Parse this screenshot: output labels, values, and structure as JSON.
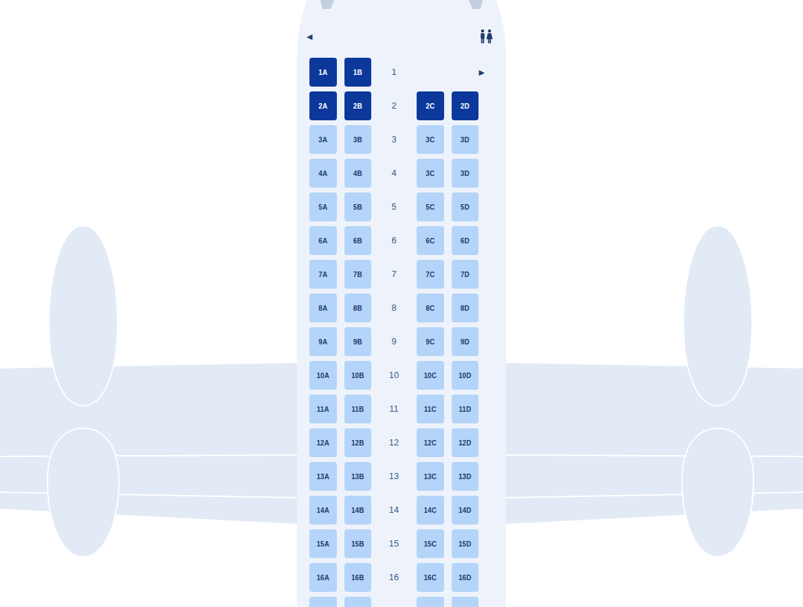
{
  "header": {
    "exit_left": "◀"
  },
  "rows": [
    {
      "number": "1",
      "exit_right": "▶",
      "seats_left": [
        {
          "label": "1A",
          "selected": true
        },
        {
          "label": "1B",
          "selected": true
        }
      ],
      "seats_right": []
    },
    {
      "number": "2",
      "seats_left": [
        {
          "label": "2A",
          "selected": true
        },
        {
          "label": "2B",
          "selected": true
        }
      ],
      "seats_right": [
        {
          "label": "2C",
          "selected": true
        },
        {
          "label": "2D",
          "selected": true
        }
      ]
    },
    {
      "number": "3",
      "seats_left": [
        {
          "label": "3A",
          "selected": false
        },
        {
          "label": "3B",
          "selected": false
        }
      ],
      "seats_right": [
        {
          "label": "3C",
          "selected": false
        },
        {
          "label": "3D",
          "selected": false
        }
      ]
    },
    {
      "number": "4",
      "seats_left": [
        {
          "label": "4A",
          "selected": false
        },
        {
          "label": "4B",
          "selected": false
        }
      ],
      "seats_right": [
        {
          "label": "3C",
          "selected": false
        },
        {
          "label": "3D",
          "selected": false
        }
      ]
    },
    {
      "number": "5",
      "seats_left": [
        {
          "label": "5A",
          "selected": false
        },
        {
          "label": "5B",
          "selected": false
        }
      ],
      "seats_right": [
        {
          "label": "5C",
          "selected": false
        },
        {
          "label": "5D",
          "selected": false
        }
      ]
    },
    {
      "number": "6",
      "seats_left": [
        {
          "label": "6A",
          "selected": false
        },
        {
          "label": "6B",
          "selected": false
        }
      ],
      "seats_right": [
        {
          "label": "6C",
          "selected": false
        },
        {
          "label": "6D",
          "selected": false
        }
      ]
    },
    {
      "number": "7",
      "seats_left": [
        {
          "label": "7A",
          "selected": false
        },
        {
          "label": "7B",
          "selected": false
        }
      ],
      "seats_right": [
        {
          "label": "7C",
          "selected": false
        },
        {
          "label": "7D",
          "selected": false
        }
      ]
    },
    {
      "number": "8",
      "seats_left": [
        {
          "label": "8A",
          "selected": false
        },
        {
          "label": "8B",
          "selected": false
        }
      ],
      "seats_right": [
        {
          "label": "8C",
          "selected": false
        },
        {
          "label": "8D",
          "selected": false
        }
      ]
    },
    {
      "number": "9",
      "seats_left": [
        {
          "label": "9A",
          "selected": false
        },
        {
          "label": "9B",
          "selected": false
        }
      ],
      "seats_right": [
        {
          "label": "9C",
          "selected": false
        },
        {
          "label": "9D",
          "selected": false
        }
      ]
    },
    {
      "number": "10",
      "seats_left": [
        {
          "label": "10A",
          "selected": false
        },
        {
          "label": "10B",
          "selected": false
        }
      ],
      "seats_right": [
        {
          "label": "10C",
          "selected": false
        },
        {
          "label": "10D",
          "selected": false
        }
      ]
    },
    {
      "number": "11",
      "seats_left": [
        {
          "label": "11A",
          "selected": false
        },
        {
          "label": "11B",
          "selected": false
        }
      ],
      "seats_right": [
        {
          "label": "11C",
          "selected": false
        },
        {
          "label": "11D",
          "selected": false
        }
      ]
    },
    {
      "number": "12",
      "seats_left": [
        {
          "label": "12A",
          "selected": false
        },
        {
          "label": "12B",
          "selected": false
        }
      ],
      "seats_right": [
        {
          "label": "12C",
          "selected": false
        },
        {
          "label": "12D",
          "selected": false
        }
      ]
    },
    {
      "number": "13",
      "seats_left": [
        {
          "label": "13A",
          "selected": false
        },
        {
          "label": "13B",
          "selected": false
        }
      ],
      "seats_right": [
        {
          "label": "13C",
          "selected": false
        },
        {
          "label": "13D",
          "selected": false
        }
      ]
    },
    {
      "number": "14",
      "seats_left": [
        {
          "label": "14A",
          "selected": false
        },
        {
          "label": "14B",
          "selected": false
        }
      ],
      "seats_right": [
        {
          "label": "14C",
          "selected": false
        },
        {
          "label": "14D",
          "selected": false
        }
      ]
    },
    {
      "number": "15",
      "seats_left": [
        {
          "label": "15A",
          "selected": false
        },
        {
          "label": "15B",
          "selected": false
        }
      ],
      "seats_right": [
        {
          "label": "15C",
          "selected": false
        },
        {
          "label": "15D",
          "selected": false
        }
      ]
    },
    {
      "number": "16",
      "seats_left": [
        {
          "label": "16A",
          "selected": false
        },
        {
          "label": "16B",
          "selected": false
        }
      ],
      "seats_right": [
        {
          "label": "16C",
          "selected": false
        },
        {
          "label": "16D",
          "selected": false
        }
      ]
    },
    {
      "number": "",
      "seats_left": [
        {
          "label": "",
          "selected": false
        },
        {
          "label": "",
          "selected": false
        }
      ],
      "seats_right": [
        {
          "label": "",
          "selected": false
        },
        {
          "label": "",
          "selected": false
        }
      ]
    }
  ]
}
